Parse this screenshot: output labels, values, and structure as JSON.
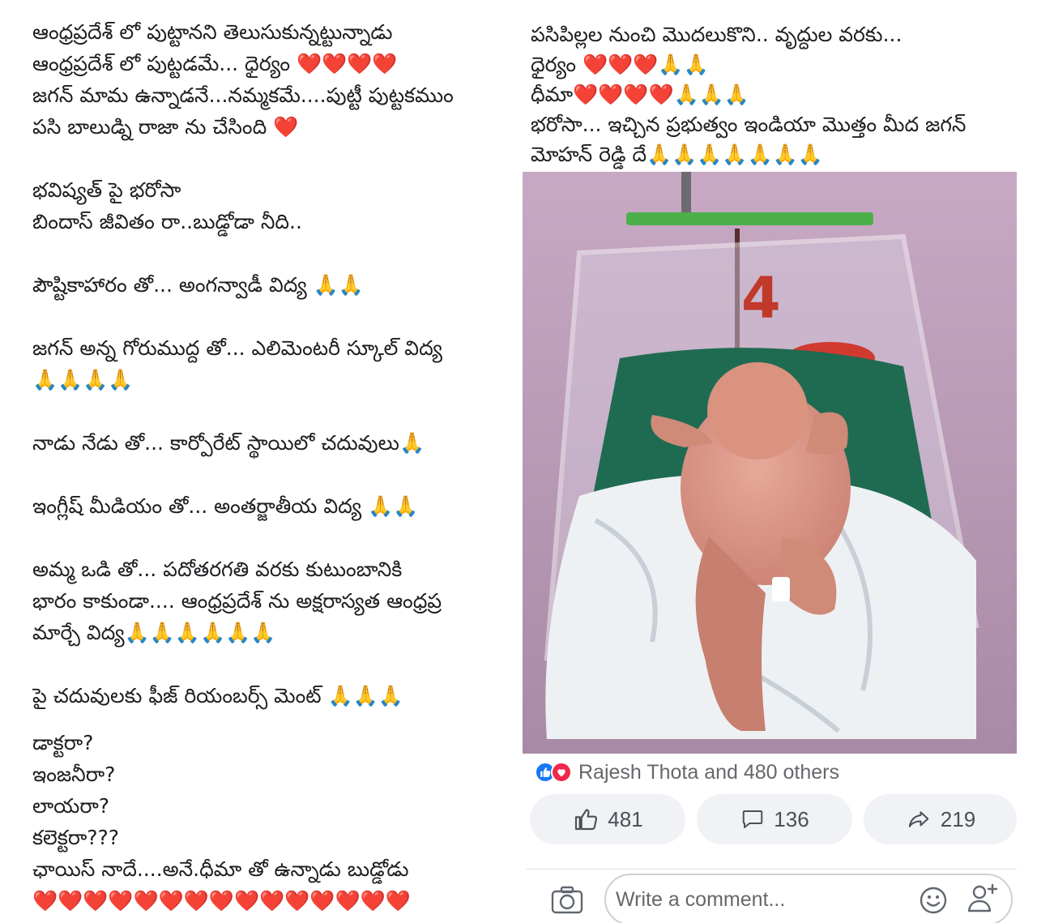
{
  "left_post": {
    "lines": [
      "ఆంధ్రప్రదేశ్ లో పుట్టానని తెలుసుకున్నట్టున్నాడు",
      "ఆంధ్రప్రదేశ్ లో పుట్టడమే... ధైర్యం ❤️❤️❤️❤️",
      "జగన్ మామ ఉన్నాడనే...నమ్మకమే....పుట్టీ పుట్టకముం",
      "పసి బాలుడ్ని రాజా ను చేసింది ❤️",
      "భవిష్యత్ పై భరోసా",
      "బిందాస్ జీవితం రా..బుడ్డోడా నీది..",
      "పౌష్టికాహారం తో... అంగన్వాడీ విద్య 🙏🙏",
      "జగన్ అన్న గోరుముద్ద తో... ఎలిమెంటరీ స్కూల్ విద్య",
      "🙏🙏🙏🙏",
      "నాడు నేడు తో... కార్పోరేట్ స్థాయిలో చదువులు🙏",
      "ఇంగ్లీష్ మీడియం తో... అంతర్జాతీయ విద్య 🙏🙏",
      "అమ్మ ఒడి తో... పదోతరగతి వరకు కుటుంబానికి",
      "భారం కాకుండా.... ఆంధ్రప్రదేశ్ ను అక్షరాస్యత ఆంధ్రప్ర",
      "మార్చే విద్య🙏🙏🙏🙏🙏🙏",
      "పై చదువులకు ఫీజ్ రియంబర్స్ మెంట్ 🙏🙏🙏",
      "డాక్టరా?",
      "ఇంజనీరా?",
      "లాయరా?",
      "కలెక్టరా???",
      "ఛాయిస్  నాదే....అనే.ధీమా తో ఉన్నాడు బుడ్డోడు",
      "❤️❤️❤️❤️❤️❤️❤️❤️❤️❤️❤️❤️❤️❤️❤️"
    ]
  },
  "right_post": {
    "lines": [
      "పసిపిల్లల నుంచి మొదలుకొని.. వృద్ధుల వరకు...",
      "ధైర్యం ❤️❤️❤️🙏🙏",
      "ధీమా❤️❤️❤️❤️🙏🙏🙏",
      "భరోసా... ఇచ్చిన ప్రభుత్వం ఇండియా మొత్తం మీద జగన్",
      "మోహన్ రెడ్డి దే🙏🙏🙏🙏🙏🙏🙏"
    ],
    "reactions_text": "Rajesh Thota and 480 others",
    "like_count": "481",
    "comment_count": "136",
    "share_count": "219",
    "comment_placeholder": "Write a comment..."
  },
  "colors": {
    "brand_blue": "#1877f2",
    "love_red": "#f0284a",
    "pill_bg": "#f0f2f5",
    "muted_text": "#65676b"
  },
  "icons": [
    "like-icon",
    "love-icon",
    "thumbs-up-icon",
    "comment-icon",
    "share-icon",
    "camera-icon",
    "emoji-icon",
    "tag-friend-icon"
  ]
}
